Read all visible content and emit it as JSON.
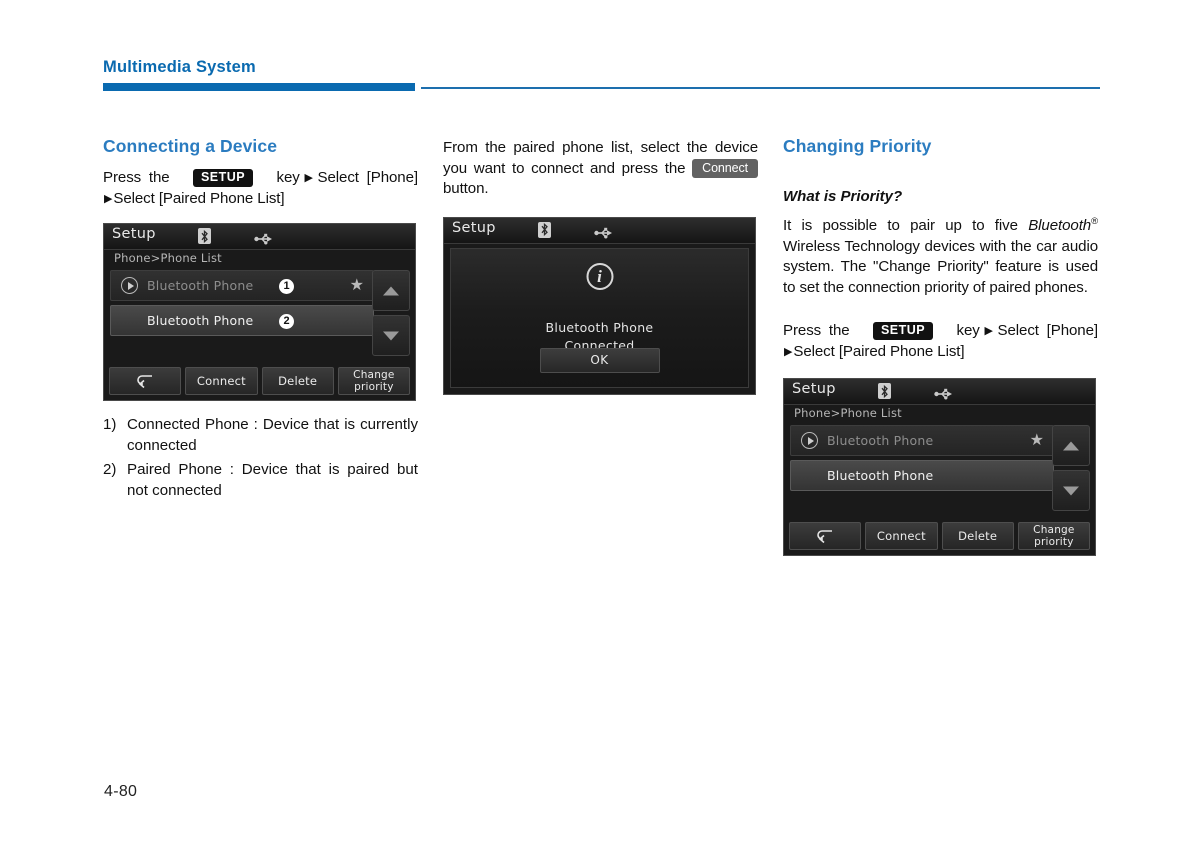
{
  "header": {
    "chapter_title": "Multimedia System",
    "rule_color": "#0a6ab0"
  },
  "colors": {
    "heading_blue": "#2b7cc0",
    "chapter_blue": "#0a6ab0",
    "badge_dark": "#111111",
    "badge_gray": "#626262"
  },
  "column1": {
    "section_title": "Connecting a Device",
    "instruction": {
      "pre": "Press the",
      "badge": "SETUP",
      "mid": "key",
      "arrow": "▶",
      "post": "Select [Phone]",
      "arrow2": "▶",
      "tail": "Select [Paired Phone List]"
    },
    "screenshot": {
      "title": "Setup",
      "breadcrumb": "Phone>Phone List",
      "bt_icon": "bluetooth-icon",
      "usb_icon": "usb-icon",
      "rows": [
        {
          "label": "Bluetooth Phone",
          "badge": "①",
          "state": "connected",
          "star": "★",
          "play": "play-icon"
        },
        {
          "label": "Bluetooth Phone",
          "badge": "②",
          "state": "paired"
        }
      ],
      "scroll_up": "▲",
      "scroll_down": "▼",
      "buttons": [
        {
          "label": "",
          "icon": "back-arrow-icon"
        },
        {
          "label": "Connect"
        },
        {
          "label": "Delete"
        },
        {
          "label": "Change\npriority",
          "line1": "Change",
          "line2": "priority"
        }
      ]
    },
    "notes": [
      {
        "marker": "1)",
        "text": "Connected Phone : Device that is currently connected"
      },
      {
        "marker": "2)",
        "text": "Paired Phone : Device that is paired but not connected"
      }
    ]
  },
  "column2": {
    "instruction": {
      "pre": "From the paired phone list, select the device you want to connect and press the",
      "badge": "Connect",
      "post": "button."
    },
    "screenshot": {
      "title": "Setup",
      "bt_icon": "bluetooth-icon",
      "usb_icon": "usb-icon",
      "info_icon": "i",
      "message_line1": "Bluetooth Phone",
      "message_line2": "Connected",
      "ok_label": "OK"
    }
  },
  "column3": {
    "section_title": "Changing Priority",
    "sub_title": "What is Priority?",
    "paragraph": {
      "part1": "It is possible to pair up to five ",
      "bluetooth": "Bluetooth",
      "registered": "®",
      "part2": " Wireless Technology devices with the car audio system. The \"Change Priority\" feature is used to set the connection priority of paired phones."
    },
    "instruction": {
      "pre": "Press the",
      "badge": "SETUP",
      "mid": "key",
      "arrow": "▶",
      "post": "Select [Phone]",
      "arrow2": "▶",
      "tail": "Select [Paired Phone List]"
    },
    "screenshot": {
      "title": "Setup",
      "breadcrumb": "Phone>Phone List",
      "bt_icon": "bluetooth-icon",
      "usb_icon": "usb-icon",
      "rows": [
        {
          "label": "Bluetooth Phone",
          "state": "connected",
          "star": "★",
          "play": "play-icon"
        },
        {
          "label": "Bluetooth Phone",
          "state": "paired"
        }
      ],
      "scroll_up": "▲",
      "scroll_down": "▼",
      "buttons": [
        {
          "label": "",
          "icon": "back-arrow-icon"
        },
        {
          "label": "Connect"
        },
        {
          "label": "Delete"
        },
        {
          "label": "Change priority",
          "line1": "Change",
          "line2": "priority"
        }
      ]
    }
  },
  "footer": {
    "page_number": "4-80"
  }
}
